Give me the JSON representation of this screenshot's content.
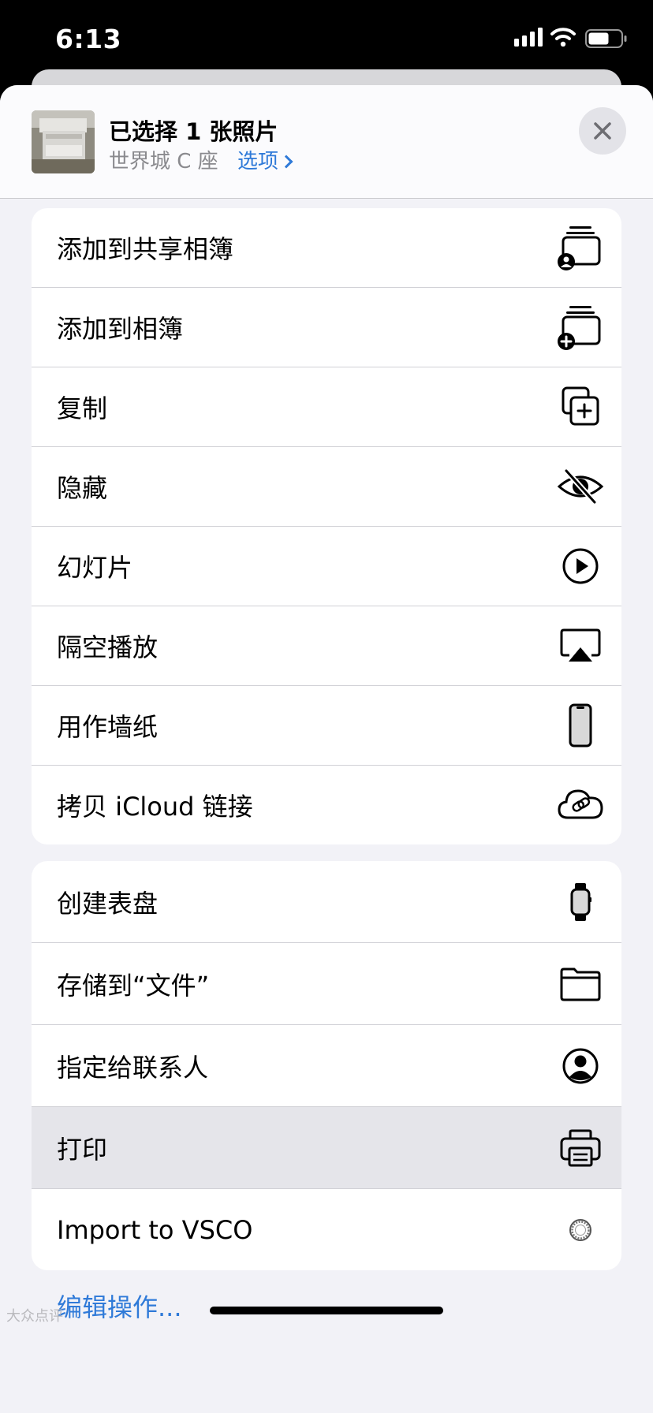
{
  "status_bar": {
    "time": "6:13"
  },
  "header": {
    "title": "已选择 1 张照片",
    "location": "世界城 C 座",
    "options_label": "选项",
    "close_icon": "xmark-icon",
    "thumbnail": "printer-photo"
  },
  "group1": [
    {
      "label": "添加到共享相簿",
      "icon": "shared-album-icon"
    },
    {
      "label": "添加到相簿",
      "icon": "add-album-icon"
    },
    {
      "label": "复制",
      "icon": "duplicate-icon"
    },
    {
      "label": "隐藏",
      "icon": "eye-slash-icon"
    },
    {
      "label": "幻灯片",
      "icon": "play-circle-icon"
    },
    {
      "label": "隔空播放",
      "icon": "airplay-icon"
    },
    {
      "label": "用作墙纸",
      "icon": "iphone-icon"
    },
    {
      "label": "拷贝 iCloud 链接",
      "icon": "icloud-link-icon"
    }
  ],
  "group2": [
    {
      "label": "创建表盘",
      "icon": "watch-icon"
    },
    {
      "label": "存储到“文件”",
      "icon": "folder-icon"
    },
    {
      "label": "指定给联系人",
      "icon": "person-circle-icon"
    },
    {
      "label": "打印",
      "icon": "printer-icon",
      "highlighted": true
    },
    {
      "label": "Import to VSCO",
      "icon": "vsco-icon"
    }
  ],
  "edit_actions": "编辑操作...",
  "watermark": "大众点评",
  "colors": {
    "accent": "#2f7ad8",
    "sheet_bg": "#f2f2f7",
    "highlight": "#e5e5ea"
  }
}
